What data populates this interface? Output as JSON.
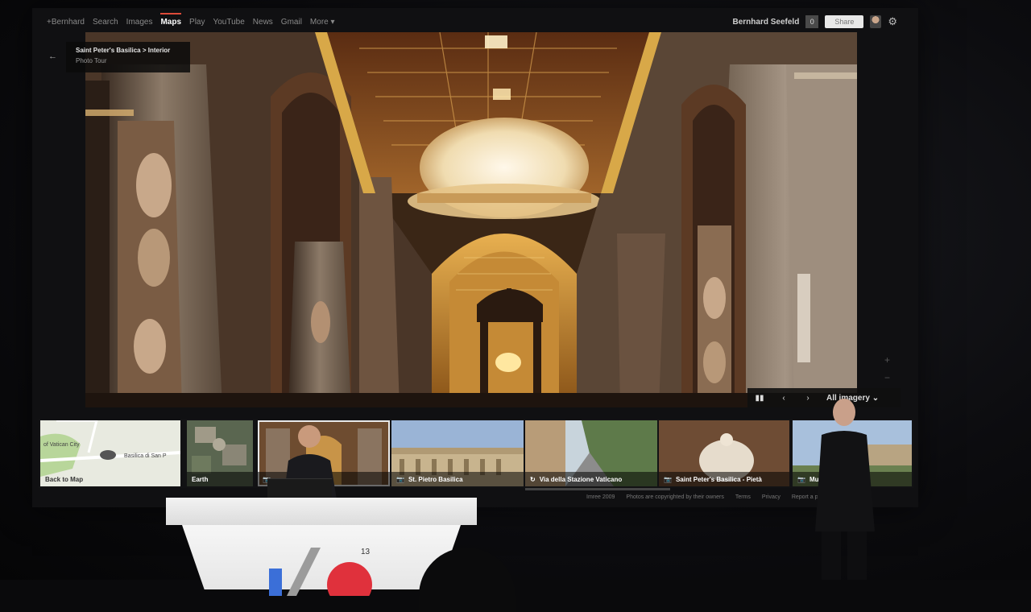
{
  "gbar": {
    "nav": [
      {
        "label": "+Bernhard",
        "active": false
      },
      {
        "label": "Search",
        "active": false
      },
      {
        "label": "Images",
        "active": false
      },
      {
        "label": "Maps",
        "active": true
      },
      {
        "label": "Play",
        "active": false
      },
      {
        "label": "YouTube",
        "active": false
      },
      {
        "label": "News",
        "active": false
      },
      {
        "label": "Gmail",
        "active": false
      },
      {
        "label": "More ▾",
        "active": false
      }
    ],
    "user": "Bernhard Seefeld",
    "notifications": "0",
    "share": "Share",
    "avatar_icon": "avatar-icon",
    "gear_icon": "gear-icon"
  },
  "photo_tour": {
    "title": "Saint Peter's Basilica > Interior",
    "subtitle": "Photo Tour"
  },
  "viewer": {
    "pause": "▮▮",
    "prev": "‹",
    "next": "›",
    "imagery": "All imagery",
    "zoom_in": "+",
    "zoom_out": "−"
  },
  "filmstrip": [
    {
      "caption": "Back to Map",
      "icon": "",
      "kind": "map",
      "map_labels": {
        "city": "of Vatican City",
        "place": "Basilica di San P"
      }
    },
    {
      "caption": "Earth",
      "icon": "",
      "kind": "aerial"
    },
    {
      "caption": "",
      "icon": "📷",
      "kind": "interior",
      "selected": true
    },
    {
      "caption": "St. Pietro Basilica",
      "icon": "📷",
      "kind": "facade"
    },
    {
      "caption": "Via della Stazione Vaticano",
      "icon": "↻",
      "kind": "street"
    },
    {
      "caption": "Saint Peter's Basilica - Pietà",
      "icon": "📷",
      "kind": "pieta"
    },
    {
      "caption": "Musei Vatic",
      "icon": "📷",
      "kind": "museum"
    }
  ],
  "footer": {
    "imagery_date": "Imree 2009",
    "copyright": "Photos are copyrighted by their owners",
    "terms": "Terms",
    "privacy": "Privacy",
    "report": "Report a problem"
  },
  "stage": {
    "logo_sup": "13"
  },
  "colors": {
    "maps_accent": "#dd4b39",
    "gold": "#c8923a"
  }
}
